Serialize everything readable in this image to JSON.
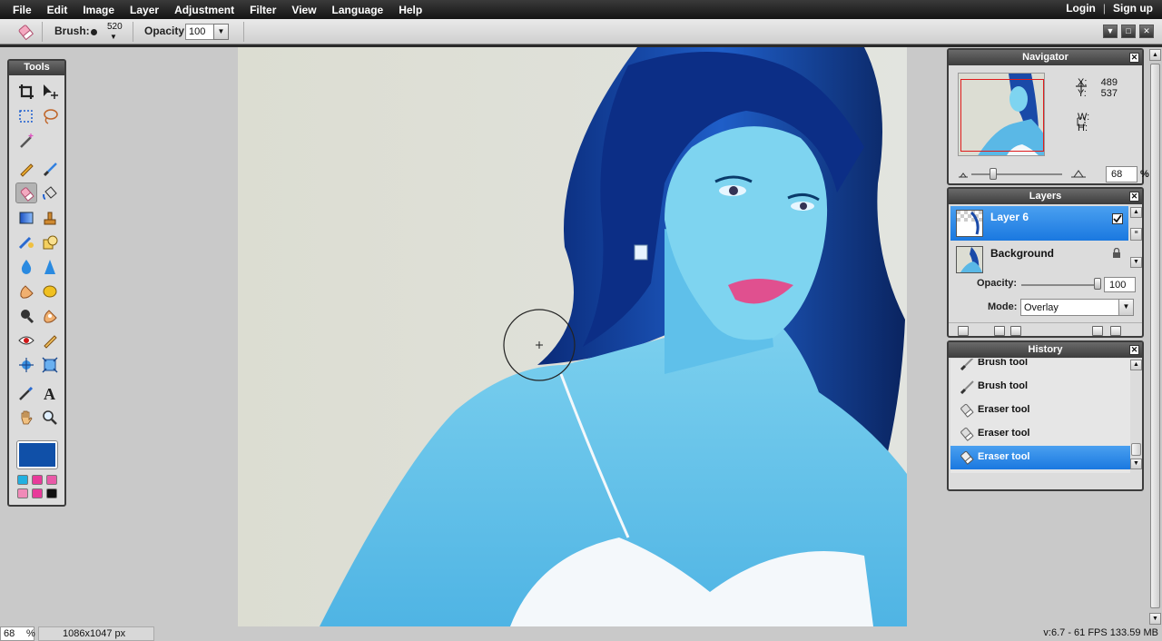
{
  "menu": {
    "items": [
      "File",
      "Edit",
      "Image",
      "Layer",
      "Adjustment",
      "Filter",
      "View",
      "Language",
      "Help"
    ],
    "login": "Login",
    "separator": "|",
    "signup": "Sign up"
  },
  "options": {
    "brush_label": "Brush:",
    "brush_size": "520",
    "opacity_label": "Opacity:",
    "opacity_value": "100"
  },
  "tools": {
    "title": "Tools",
    "foreground_color": "#1050a8",
    "swatches": [
      "#22b0e0",
      "#e83a9a",
      "#e85aa8",
      "#f08ab8",
      "#e83a9a",
      "#111111"
    ]
  },
  "navigator": {
    "title": "Navigator",
    "x_label": "X:",
    "x_value": "489",
    "y_label": "Y:",
    "y_value": "537",
    "w_label": "W:",
    "h_label": "H:",
    "zoom": "68",
    "zoom_unit": "%"
  },
  "layers": {
    "title": "Layers",
    "items": [
      {
        "name": "Layer 6",
        "visible": true,
        "selected": true
      },
      {
        "name": "Background",
        "locked": true,
        "selected": false
      }
    ],
    "opacity_label": "Opacity:",
    "opacity_value": "100",
    "mode_label": "Mode:",
    "mode_value": "Overlay"
  },
  "history": {
    "title": "History",
    "items": [
      {
        "label": "Brush tool",
        "icon": "brush-icon"
      },
      {
        "label": "Brush tool",
        "icon": "brush-icon"
      },
      {
        "label": "Eraser tool",
        "icon": "eraser-icon"
      },
      {
        "label": "Eraser tool",
        "icon": "eraser-icon"
      },
      {
        "label": "Eraser tool",
        "icon": "eraser-icon",
        "selected": true
      }
    ]
  },
  "status": {
    "zoom": "68",
    "zoom_unit": "%",
    "dimensions": "1086x1047 px",
    "version": "v:6.7 - 61 FPS 133.59 MB"
  },
  "colors": {
    "selection_blue": "#1a78e0",
    "panel_bg": "#dcdcdc",
    "menubar_bg": "#141414"
  }
}
